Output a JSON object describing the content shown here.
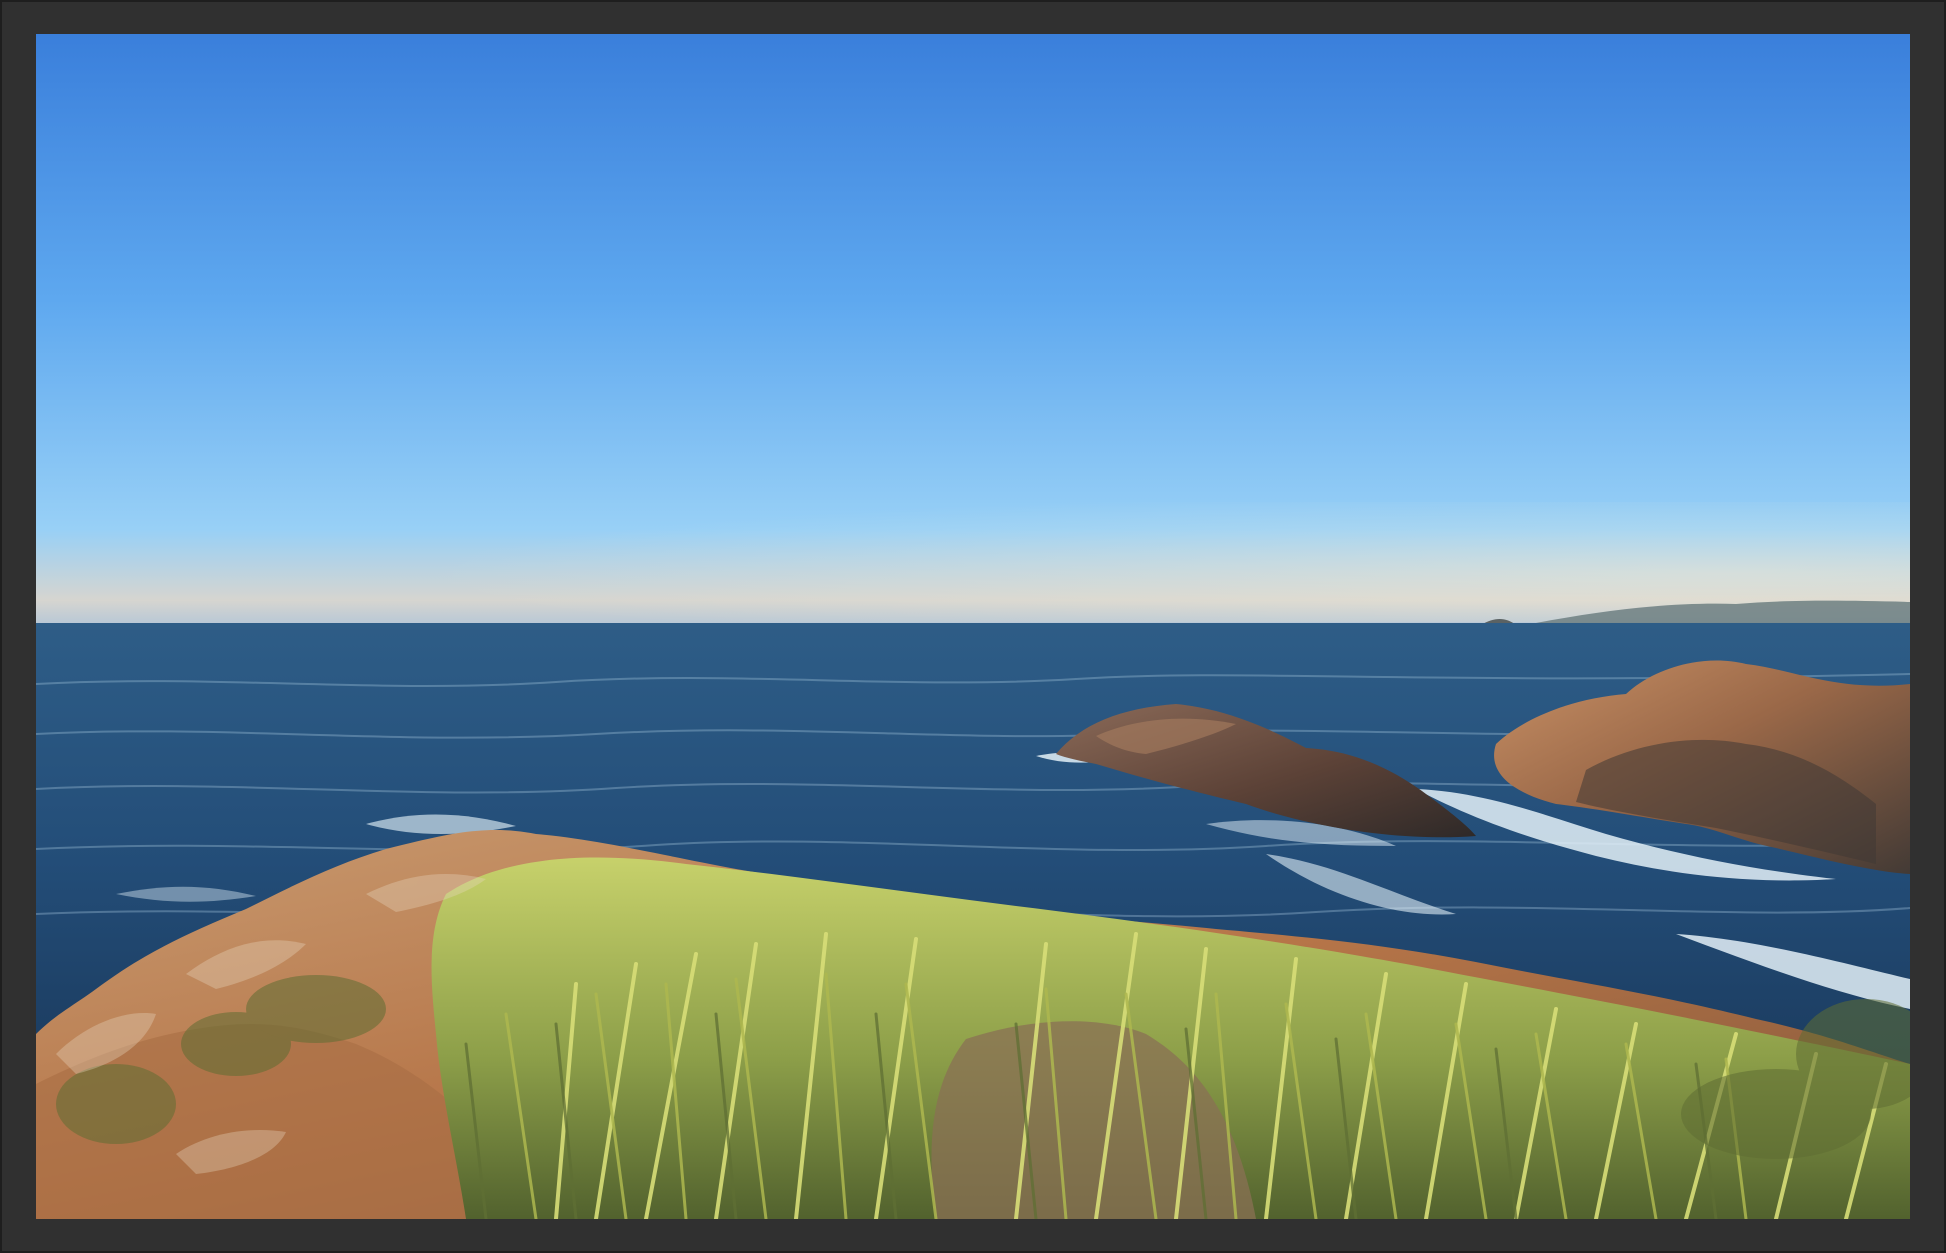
{
  "photo": {
    "subject": "coastal-landscape",
    "colors": {
      "frame": "#303030",
      "sky_top": "#3e83dd",
      "sky_mid": "#68b0ef",
      "sky_horizon": "#d9d2c8",
      "sea_far": "#24507a",
      "sea_near": "#193a5a",
      "surf": "#d8eaf5",
      "rock_sunlit": "#b7794c",
      "rock_shadow": "#4a3a34",
      "grass": "#b8c15a",
      "grass_shadow": "#5f6f34",
      "path": "#8c7255"
    }
  }
}
